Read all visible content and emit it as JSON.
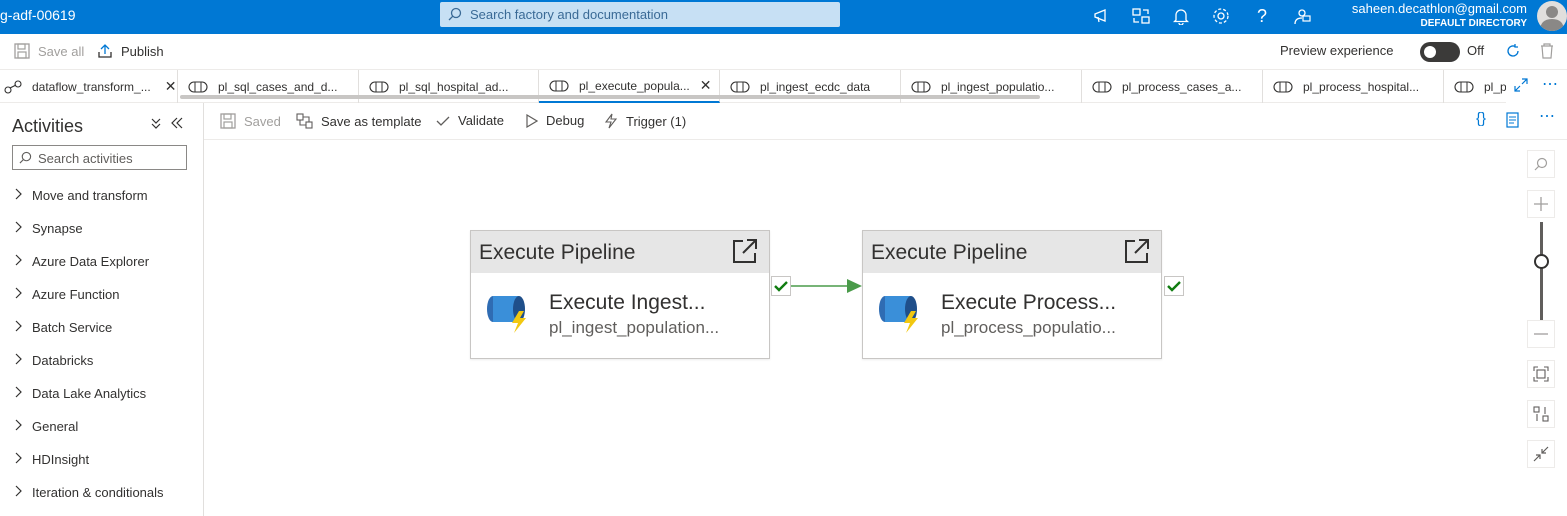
{
  "topbar": {
    "app_title": "g-adf-00619",
    "search_placeholder": "Search factory and documentation",
    "account_email": "saheen.decathlon@gmail.com",
    "account_directory": "DEFAULT DIRECTORY",
    "icons": [
      "announcement-icon",
      "switch-directory-icon",
      "notifications-icon",
      "settings-icon",
      "help-icon",
      "feedback-icon"
    ]
  },
  "commandbar": {
    "save_all": "Save all",
    "publish": "Publish",
    "preview_label": "Preview experience",
    "preview_state": "Off"
  },
  "tabs": [
    {
      "label": "dataflow_transform_..."
    },
    {
      "label": "pl_sql_cases_and_d..."
    },
    {
      "label": "pl_sql_hospital_ad..."
    },
    {
      "label": "pl_execute_popula..."
    },
    {
      "label": "pl_ingest_ecdc_data"
    },
    {
      "label": "pl_ingest_populatio..."
    },
    {
      "label": "pl_process_cases_a..."
    },
    {
      "label": "pl_process_hospital..."
    },
    {
      "label": "pl_p"
    }
  ],
  "activities": {
    "title": "Activities",
    "search_placeholder": "Search activities",
    "items": [
      "Move and transform",
      "Synapse",
      "Azure Data Explorer",
      "Azure Function",
      "Batch Service",
      "Databricks",
      "Data Lake Analytics",
      "General",
      "HDInsight",
      "Iteration & conditionals"
    ]
  },
  "canvas_toolbar": {
    "saved": "Saved",
    "save_as_template": "Save as template",
    "validate": "Validate",
    "debug": "Debug",
    "trigger": "Trigger (1)"
  },
  "nodes": [
    {
      "type": "Execute Pipeline",
      "name": "Execute Ingest...",
      "pipeline": "pl_ingest_population..."
    },
    {
      "type": "Execute Pipeline",
      "name": "Execute Process...",
      "pipeline": "pl_process_populatio..."
    }
  ],
  "colors": {
    "brand": "#0078d4",
    "success": "#107c10",
    "connector": "#4a9b4a"
  }
}
